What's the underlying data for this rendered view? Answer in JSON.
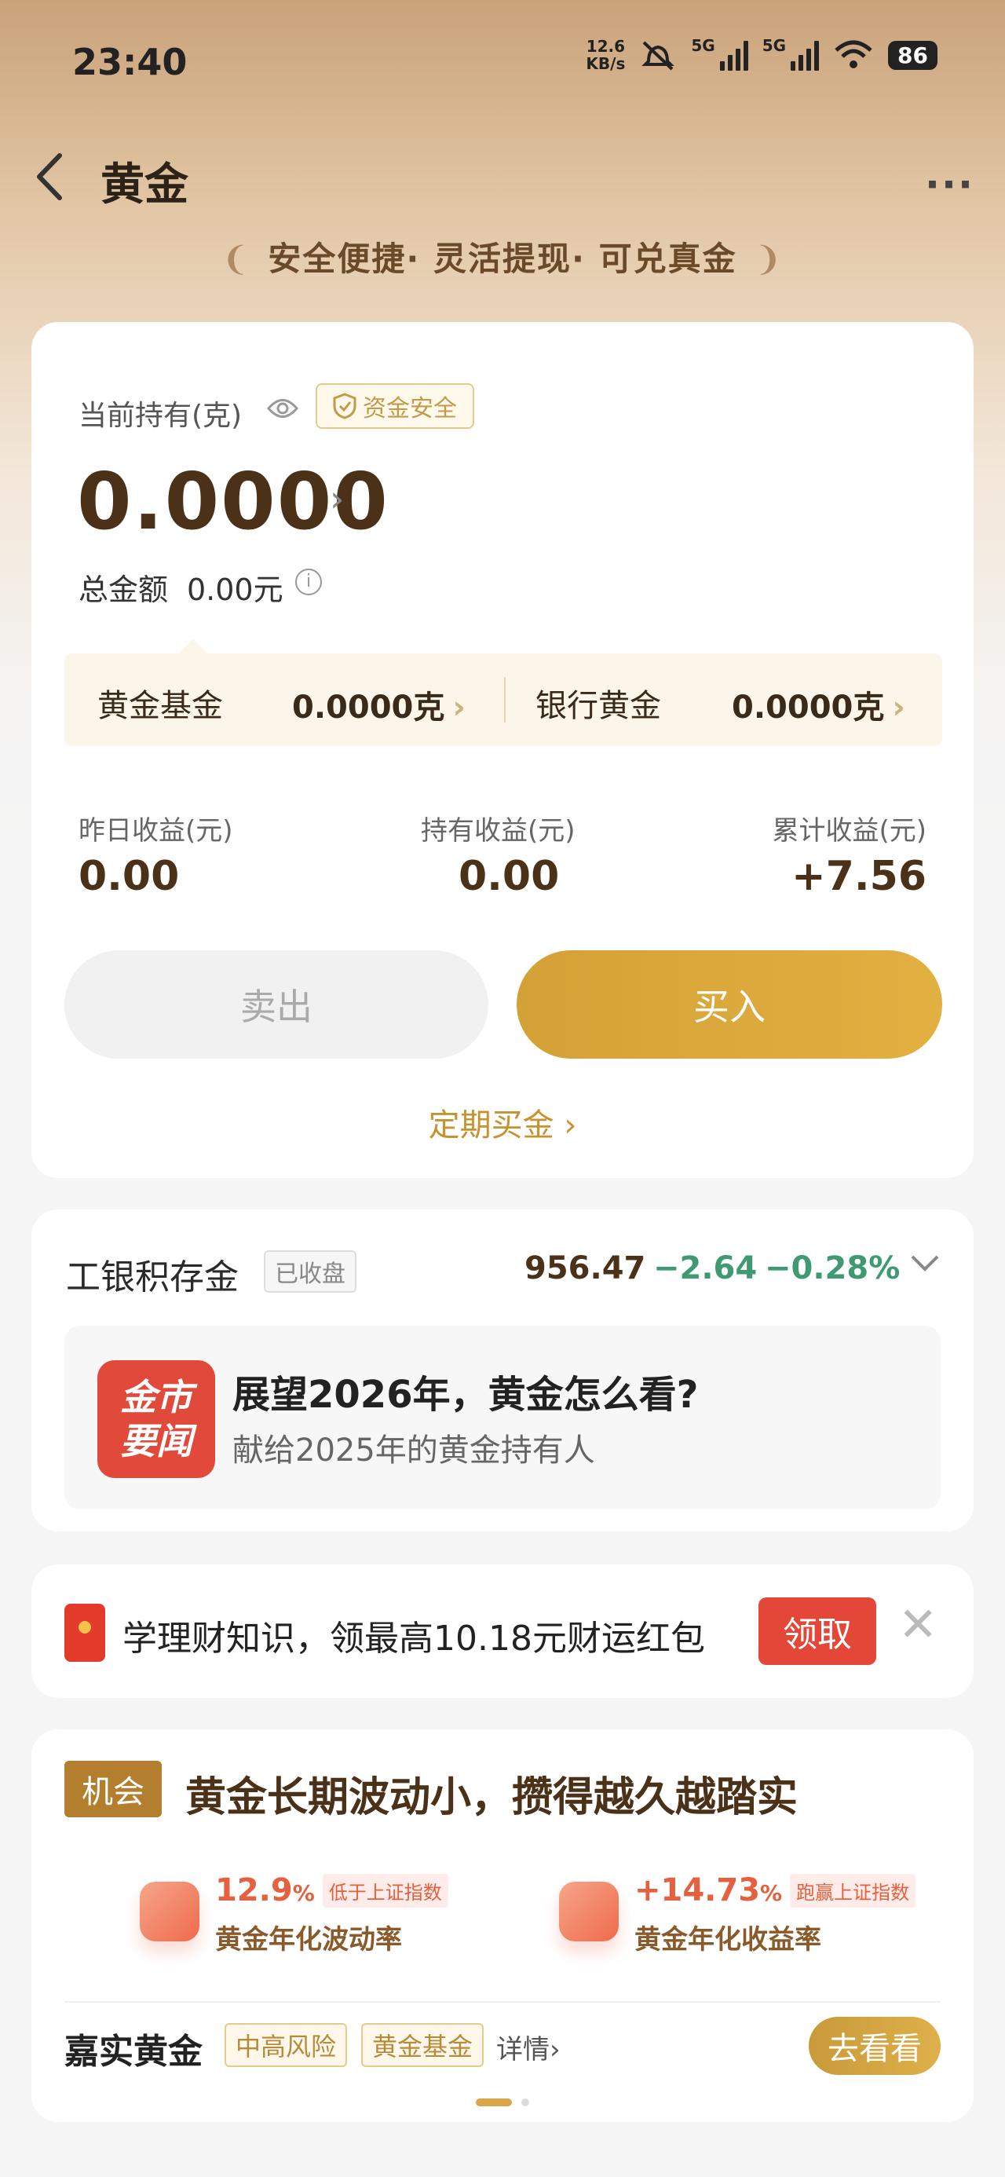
{
  "status_bar": {
    "time": "23:40",
    "net_speed_value": "12.6",
    "net_speed_unit": "KB/s",
    "network1": "5G",
    "network2": "5G",
    "battery": "86"
  },
  "header": {
    "title": "黄金",
    "more": "···"
  },
  "slogan": {
    "items": [
      "安全便捷",
      "灵活提现",
      "可兑真金"
    ],
    "sep": "·"
  },
  "holdings": {
    "label": "当前持有(克)",
    "badge": "资金安全",
    "amount": "0.0000",
    "total_label": "总金额",
    "total_value": "0.00元",
    "fund_label": "黄金基金",
    "fund_value": "0.0000克",
    "bank_label": "银行黄金",
    "bank_value": "0.0000克",
    "earnings": [
      {
        "label": "昨日收益(元)",
        "value": "0.00"
      },
      {
        "label": "持有收益(元)",
        "value": "0.00"
      },
      {
        "label": "累计收益(元)",
        "value": "+7.56"
      }
    ],
    "sell": "卖出",
    "buy": "买入",
    "regular": "定期买金"
  },
  "market": {
    "name": "工银积存金",
    "status": "已收盘",
    "price": "956.47",
    "change": "−2.64",
    "percent": "−0.28%",
    "news_icon_line1": "金市",
    "news_icon_line2": "要闻",
    "news_title": "展望2026年，黄金怎么看?",
    "news_subtitle": "献给2025年的黄金持有人"
  },
  "reward": {
    "text": "学理财知识，领最高10.18元财运红包",
    "claim": "领取"
  },
  "opportunity": {
    "tag": "机会",
    "title": "黄金长期波动小，攒得越久越踏实",
    "stats": [
      {
        "value": "12.9",
        "unit": "%",
        "chip": "低于上证指数",
        "desc": "黄金年化波动率"
      },
      {
        "value": "+14.73",
        "unit": "%",
        "chip": "跑赢上证指数",
        "desc": "黄金年化收益率"
      }
    ],
    "fund_name": "嘉实黄金",
    "tags": [
      "中高风险",
      "黄金基金"
    ],
    "details": "详情",
    "go": "去看看"
  },
  "colors": {
    "gold": "#d4a136",
    "brown_text": "#4a3118",
    "down_green": "#3f9a72",
    "red": "#e44637"
  }
}
